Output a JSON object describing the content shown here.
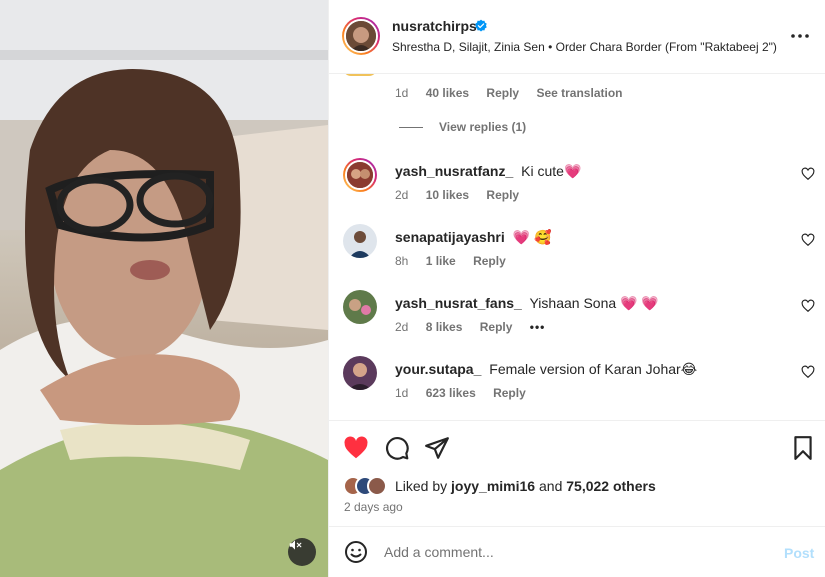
{
  "post": {
    "username": "nusratchirps",
    "song": "Shrestha D, Silajit, Zinia Sen • Order Chara Border (From \"Raktabeej 2\")"
  },
  "partial_comment": {
    "time": "1d",
    "likes": "40 likes",
    "reply": "Reply",
    "see_translation": "See translation",
    "view_replies": "View replies (1)"
  },
  "comments": [
    {
      "username": "yash_nusratfanz_",
      "text": "Ki cute💗",
      "time": "2d",
      "likes": "10 likes",
      "reply": "Reply"
    },
    {
      "username": "senapatijayashri",
      "text": "💗 🥰",
      "time": "8h",
      "likes": "1 like",
      "reply": "Reply"
    },
    {
      "username": "yash_nusrat_fans_",
      "text": "Yishaan Sona 💗 💗",
      "time": "2d",
      "likes": "8 likes",
      "reply": "Reply",
      "more": "•••"
    },
    {
      "username": "your.sutapa_",
      "text": "Female version of Karan Johar😂",
      "time": "1d",
      "likes": "623 likes",
      "reply": "Reply"
    }
  ],
  "likes": {
    "prefix": "Liked by",
    "user": "joyy_mimi16",
    "conj": "and",
    "others": "75,022 others"
  },
  "time_ago": "2 days ago",
  "add_comment": {
    "placeholder": "Add a comment...",
    "post_label": "Post"
  },
  "icons": {
    "like": "heart-filled-icon",
    "comment": "comment-icon",
    "share": "send-icon",
    "save": "bookmark-icon",
    "mute": "speaker-muted-icon",
    "more": "more-horizontal-icon",
    "emoji": "smiley-icon",
    "verified": "verified-badge-icon"
  },
  "colors": {
    "like_red": "#ff3040",
    "verified_blue": "#0095f6",
    "post_disabled": "#b2dffc",
    "secondary_text": "#737373"
  }
}
